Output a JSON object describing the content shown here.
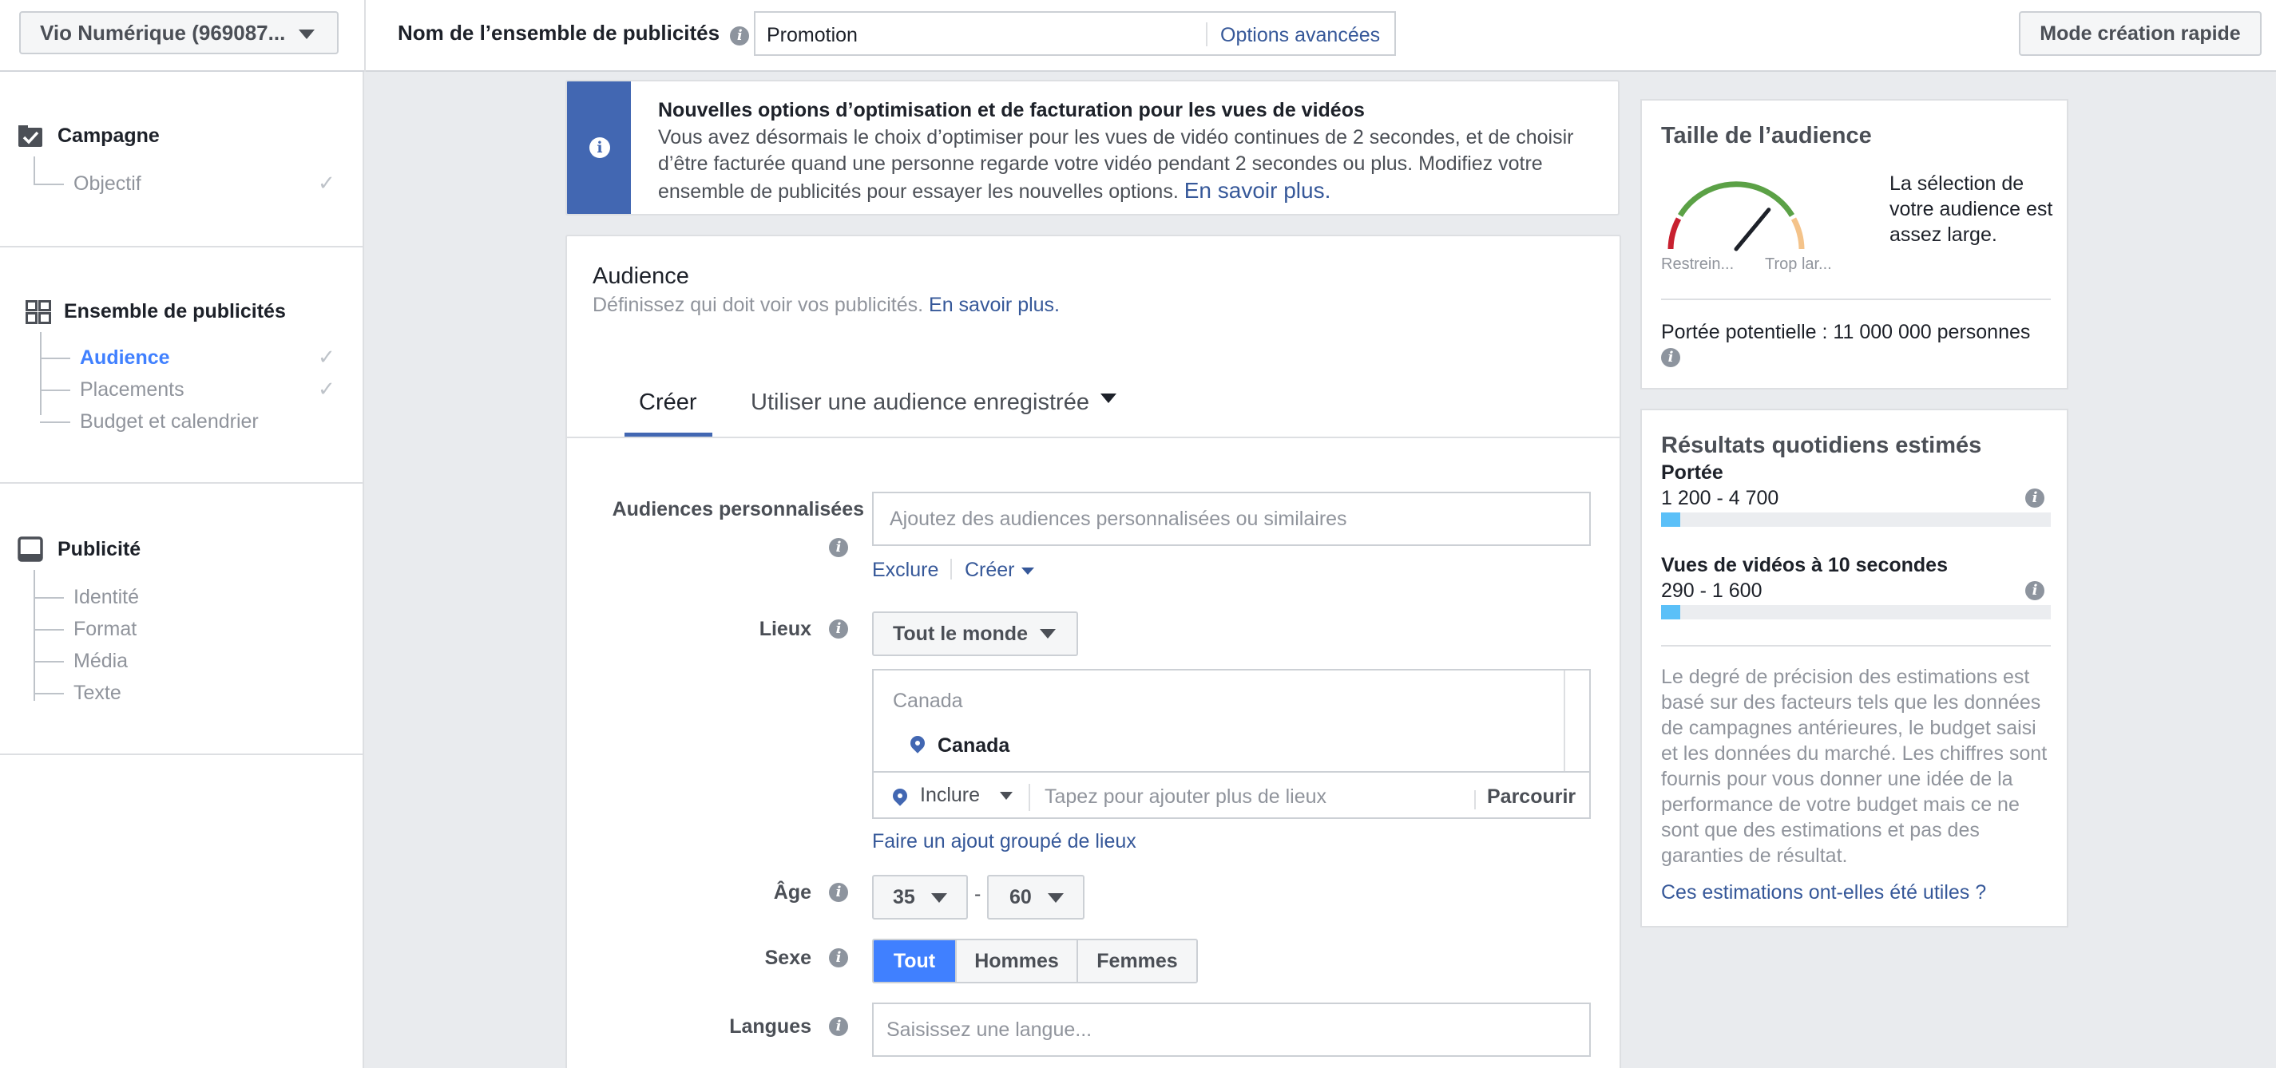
{
  "topbar": {
    "account": "Vio Numérique (969087...",
    "adset_label": "Nom de l’ensemble de publicités",
    "adset_name": "Promotion",
    "advanced_options": "Options avancées",
    "quick_mode": "Mode création rapide"
  },
  "sidebar": {
    "campaign": {
      "title": "Campagne",
      "items": [
        {
          "label": "Objectif",
          "checked": true
        }
      ]
    },
    "adset": {
      "title": "Ensemble de publicités",
      "items": [
        {
          "label": "Audience",
          "checked": true,
          "active": true
        },
        {
          "label": "Placements",
          "checked": true
        },
        {
          "label": "Budget et calendrier",
          "checked": false
        }
      ]
    },
    "ad": {
      "title": "Publicité",
      "items": [
        {
          "label": "Identité"
        },
        {
          "label": "Format"
        },
        {
          "label": "Média"
        },
        {
          "label": "Texte"
        }
      ]
    }
  },
  "banner": {
    "title": "Nouvelles options d’optimisation et de facturation pour les vues de vidéos",
    "text": "Vous avez désormais le choix d’optimiser pour les vues de vidéo continues de 2 secondes, et de choisir d’être facturée quand une personne regarde votre vidéo pendant 2 secondes ou plus. Modifiez votre ensemble de publicités pour essayer les nouvelles options.",
    "link": "En savoir plus."
  },
  "audience": {
    "title": "Audience",
    "subtitle": "Définissez qui doit voir vos publicités.",
    "subtitle_link": "En savoir plus.",
    "tabs": [
      {
        "label": "Créer",
        "active": true
      },
      {
        "label": "Utiliser une audience enregistrée",
        "active": false
      }
    ],
    "custom_audiences": {
      "label": "Audiences personnalisées",
      "placeholder": "Ajoutez des audiences personnalisées ou similaires",
      "exclude": "Exclure",
      "create": "Créer"
    },
    "locations": {
      "label": "Lieux",
      "scope": "Tout le monde",
      "country_header": "Canada",
      "selected": "Canada",
      "include": "Inclure",
      "placeholder": "Tapez pour ajouter plus de lieux",
      "browse": "Parcourir",
      "bulk_link": "Faire un ajout groupé de lieux"
    },
    "age": {
      "label": "Âge",
      "min": "35",
      "max": "60",
      "separator": "-"
    },
    "gender": {
      "label": "Sexe",
      "options": [
        "Tout",
        "Hommes",
        "Femmes"
      ],
      "selected": "Tout"
    },
    "languages": {
      "label": "Langues",
      "placeholder": "Saisissez une langue..."
    }
  },
  "audience_size": {
    "title": "Taille de l’audience",
    "description": "La sélection de votre audience est assez large.",
    "left_label": "Restrein...",
    "right_label": "Trop lar...",
    "gauge_level": 0.72,
    "potential_reach": "Portée potentielle : 11 000 000 personnes"
  },
  "daily_results": {
    "title": "Résultats quotidiens estimés",
    "metrics": [
      {
        "label": "Portée",
        "value": "1 200 - 4 700",
        "fill": 0.05
      },
      {
        "label": "Vues de vidéos à 10 secondes",
        "value": "290 - 1 600",
        "fill": 0.05
      }
    ],
    "disclaimer": "Le degré de précision des estimations est basé sur des facteurs tels que les données de campagnes antérieures, le budget saisi et les données du marché. Les chiffres sont fournis pour vous donner une idée de la performance de votre budget mais ce ne sont que des estimations et pas des garanties de résultat.",
    "feedback_link": "Ces estimations ont-elles été utiles ?"
  },
  "colors": {
    "brand": "#4267b2",
    "link": "#365899",
    "active": "#4080ff",
    "bar": "#5bc0f8"
  }
}
